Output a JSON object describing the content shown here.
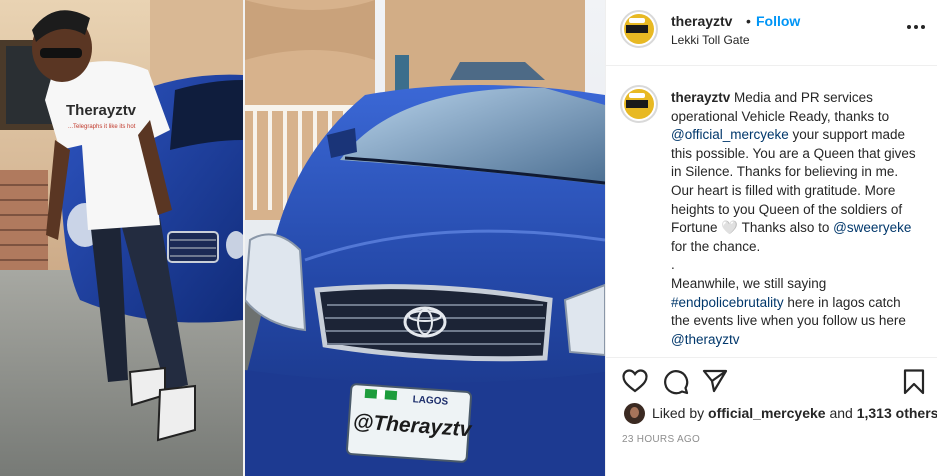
{
  "post": {
    "username": "therayztv",
    "follow_label": "Follow",
    "dot_separator": "•",
    "location": "Lekki Toll Gate",
    "caption": {
      "username": "therayztv",
      "text1": " Media and PR services operational Vehicle Ready, thanks to ",
      "mention1": "@official_mercyeke",
      "text2": " your support made this possible. You are a Queen that gives in Silence. Thanks for believing in me. Our heart is filled with gratitude. More heights to you Queen of the soldiers of Fortune 🤍 Thanks also to ",
      "mention2": "@sweeryeke",
      "text3": " for the chance.",
      "line_break": ".",
      "text4": "Meanwhile, we still saying ",
      "hashtag": "#endpolicebrutality",
      "text5": " here in lagos catch the events live when you follow us here ",
      "mention3": "@therayztv"
    },
    "likes": {
      "prefix": "Liked by ",
      "liker": "official_mercyeke",
      "middle": " and ",
      "count": "1,313 others"
    },
    "timestamp": "23 HOURS AGO"
  },
  "photo": {
    "shirt_brand": "Therayztv",
    "shirt_tagline": "...Telegraphs it like its hot",
    "plate_top": "LAGOS",
    "plate_handle": "@Therayztv"
  },
  "icons": {
    "more": "more-options-icon",
    "heart": "heart-icon",
    "comment": "comment-icon",
    "share": "share-icon",
    "save": "bookmark-icon"
  },
  "colors": {
    "follow": "#0095f6",
    "link": "#00376b",
    "meta": "#8e8e8e",
    "car": "#1f3f9c"
  }
}
